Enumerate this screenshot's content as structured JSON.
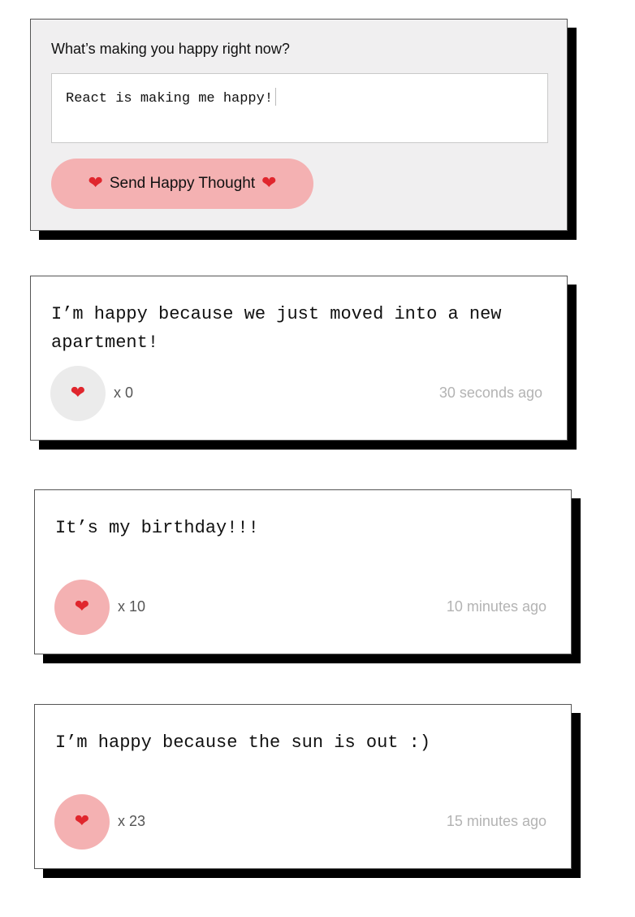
{
  "form": {
    "label": "What’s making you happy right now?",
    "input_value": "React is making me happy!",
    "button": {
      "icon_left": "heart-icon",
      "label": "Send Happy Thought",
      "icon_right": "heart-icon",
      "heart_glyph": "❤"
    },
    "colors": {
      "background": "#f0eff0",
      "button": "#f4b1b2"
    }
  },
  "thoughts": [
    {
      "message": "I’m happy because we just moved into a new apartment!",
      "like_count": "x 0",
      "liked": false,
      "time": "30 seconds ago"
    },
    {
      "message": "It’s my birthday!!!",
      "like_count": "x 10",
      "liked": true,
      "time": "10 minutes ago"
    },
    {
      "message": "I’m happy because the sun is out :)",
      "like_count": "x 23",
      "liked": true,
      "time": "15 minutes ago"
    }
  ],
  "heart": "❤",
  "colors": {
    "liked": "#f4b1b2",
    "unliked": "#ebebeb",
    "heart": "#e0262d",
    "shadow": "#000000"
  }
}
